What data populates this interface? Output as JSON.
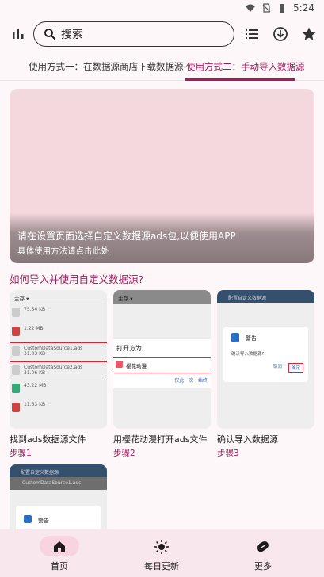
{
  "status_bar": {
    "time": "5:24"
  },
  "search": {
    "label": "搜索"
  },
  "tabs": [
    {
      "label": "使用方式一：在数据源商店下载数据源",
      "active": false
    },
    {
      "label": "使用方式二：手动导入数据源",
      "active": true
    }
  ],
  "banner": {
    "title": "请在设置页面选择自定义数据源ads包,以便使用APP",
    "subtitle": "具体使用方法请点击此处"
  },
  "section_title": "如何导入并使用自定义数据源?",
  "steps": [
    {
      "caption": "找到ads数据源文件",
      "step": "步骤1",
      "thumb": {
        "bar": "主存 ▾",
        "files": [
          {
            "name": "",
            "size": "75.54 KB"
          },
          {
            "name": "",
            "size": "1.22 MB"
          },
          {
            "name": "CustomDataSource1.ads",
            "size": "31.03 KB"
          },
          {
            "name": "CustomDataSource2.ads",
            "size": "31.06 KB"
          },
          {
            "name": "",
            "size": "43.22 MB"
          },
          {
            "name": "",
            "size": "11.63 KB"
          }
        ]
      }
    },
    {
      "caption": "用樱花动漫打开ads文件",
      "step": "步骤2",
      "thumb": {
        "bar": "主存 ▾",
        "title": "打开方为",
        "app": "樱花动漫",
        "once": "仅此一次",
        "always": "始终"
      }
    },
    {
      "caption": "确认导入数据源",
      "step": "步骤3",
      "thumb": {
        "bar": "配置自定义数据源",
        "dialog_title": "警告",
        "question": "确认导入数据源?",
        "cancel": "取消",
        "ok": "确定"
      }
    },
    {
      "caption": "",
      "step": "",
      "thumb": {
        "bar": "配置自定义数据源",
        "row": "CustomDataSource1.ads",
        "dialog_title": "警告"
      }
    }
  ],
  "bottom_nav": [
    {
      "label": "首页",
      "icon": "home-icon",
      "active": true
    },
    {
      "label": "每日更新",
      "icon": "sun-icon",
      "active": false
    },
    {
      "label": "更多",
      "icon": "bean-icon",
      "active": false
    }
  ],
  "colors": {
    "accent": "#a3195b",
    "banner": "#f3d9dd",
    "nav_bg": "#f8e8ee",
    "nav_active": "#f8d4e0"
  }
}
